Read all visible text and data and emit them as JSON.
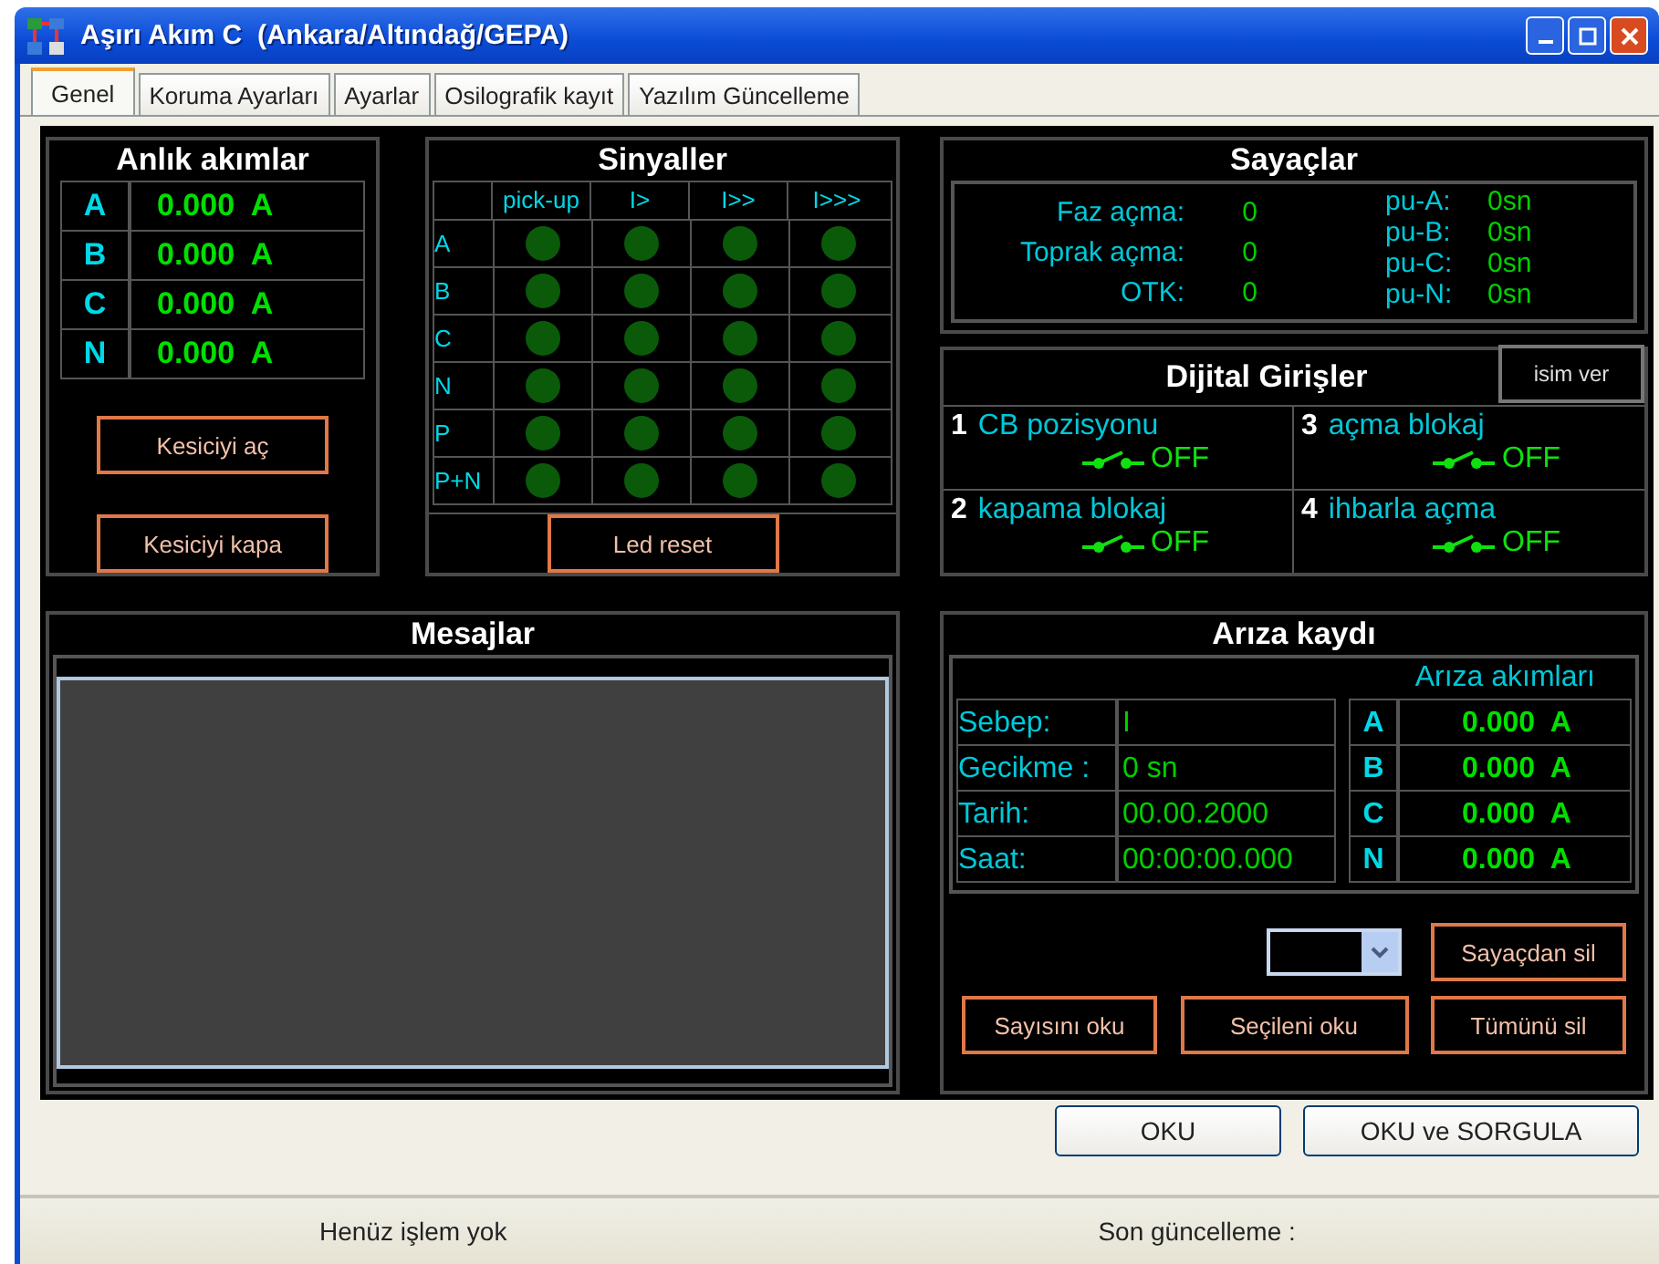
{
  "window": {
    "title": "Aşırı Akım C  (Ankara/Altındağ/GEPA)"
  },
  "tabs": [
    {
      "label": "Genel",
      "selected": true
    },
    {
      "label": "Koruma Ayarları",
      "selected": false
    },
    {
      "label": "Ayarlar",
      "selected": false
    },
    {
      "label": "Osilografik kayıt",
      "selected": false
    },
    {
      "label": "Yazılım Güncelleme",
      "selected": false
    }
  ],
  "instant_currents": {
    "title": "Anlık akımlar",
    "rows": [
      {
        "phase": "A",
        "value": "0.000  A"
      },
      {
        "phase": "B",
        "value": "0.000  A"
      },
      {
        "phase": "C",
        "value": "0.000  A"
      },
      {
        "phase": "N",
        "value": "0.000  A"
      }
    ],
    "buttons": [
      "Kesiciyi aç",
      "Kesiciyi kapa"
    ]
  },
  "signals": {
    "title": "Sinyaller",
    "columns": [
      "pick-up",
      "I>",
      "I>>",
      "I>>>"
    ],
    "rows": [
      {
        "label": "A",
        "leds": [
          {
            "on": false
          },
          {
            "on": false
          },
          {
            "on": false
          },
          {
            "on": false
          }
        ]
      },
      {
        "label": "B",
        "leds": [
          {
            "on": false
          },
          {
            "on": false
          },
          {
            "on": false
          },
          {
            "on": false
          }
        ]
      },
      {
        "label": "C",
        "leds": [
          {
            "on": false
          },
          {
            "on": false
          },
          {
            "on": false
          },
          {
            "on": false
          }
        ]
      },
      {
        "label": "N",
        "leds": [
          {
            "on": false
          },
          {
            "on": false
          },
          {
            "on": false
          },
          {
            "on": false
          }
        ]
      },
      {
        "label": "P",
        "leds": [
          {
            "on": false
          },
          {
            "on": false
          },
          {
            "on": false
          },
          {
            "on": false
          }
        ]
      },
      {
        "label": "P+N",
        "leds": [
          {
            "on": false
          },
          {
            "on": false
          },
          {
            "on": false
          },
          {
            "on": false
          }
        ]
      }
    ],
    "reset_button": "Led reset"
  },
  "counters": {
    "title": "Sayaçlar",
    "items": [
      {
        "label": "Faz açma:",
        "value": "0"
      },
      {
        "label": "Toprak açma:",
        "value": "0"
      },
      {
        "label": "OTK:",
        "value": "0"
      }
    ],
    "pickups": [
      {
        "label": "pu-A:",
        "value": "0sn"
      },
      {
        "label": "pu-B:",
        "value": "0sn"
      },
      {
        "label": "pu-C:",
        "value": "0sn"
      },
      {
        "label": "pu-N:",
        "value": "0sn"
      }
    ]
  },
  "digital_inputs": {
    "title": "Dijital Girişler",
    "rename_button": "isim ver",
    "inputs": [
      {
        "number": "1",
        "name": "CB pozisyonu",
        "state": "OFF"
      },
      {
        "number": "3",
        "name": "açma blokaj",
        "state": "OFF"
      },
      {
        "number": "2",
        "name": "kapama blokaj",
        "state": "OFF"
      },
      {
        "number": "4",
        "name": "ihbarla açma",
        "state": "OFF"
      }
    ]
  },
  "messages": {
    "title": "Mesajlar"
  },
  "fault_record": {
    "title": "Arıza kaydı",
    "currents_title": "Arıza akımları",
    "fields": [
      {
        "label": "Sebep:",
        "value": "I"
      },
      {
        "label": "Gecikme :",
        "value": "0 sn"
      },
      {
        "label": "Tarih:",
        "value": "00.00.2000"
      },
      {
        "label": "Saat:",
        "value": "00:00:00.000"
      }
    ],
    "currents": [
      {
        "phase": "A",
        "value": "0.000  A"
      },
      {
        "phase": "B",
        "value": "0.000  A"
      },
      {
        "phase": "C",
        "value": "0.000  A"
      },
      {
        "phase": "N",
        "value": "0.000  A"
      }
    ],
    "buttons": [
      "Sayaçdan sil",
      "Sayısını oku",
      "Seçileni oku",
      "Tümünü sil"
    ]
  },
  "actions": [
    "OKU",
    "OKU ve SORGULA"
  ],
  "status_bar": [
    "Henüz işlem yok",
    "Son güncelleme :"
  ]
}
